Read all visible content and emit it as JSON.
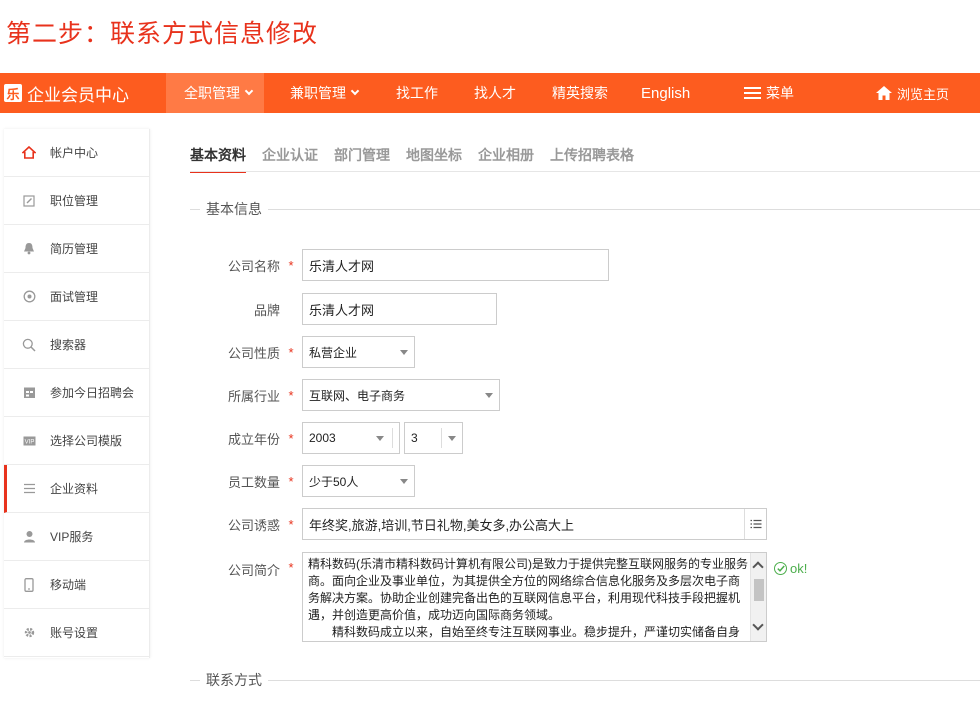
{
  "step_title": "第二步：联系方式信息修改",
  "topbar": {
    "brand_logo": "乐",
    "brand_name": "企业会员中心",
    "nav": [
      {
        "label": "全职管理"
      },
      {
        "label": "兼职管理"
      },
      {
        "label": "找工作"
      },
      {
        "label": "找人才"
      },
      {
        "label": "精英搜索"
      },
      {
        "label": "English"
      },
      {
        "label": "菜单"
      },
      {
        "label": "浏览主页"
      }
    ]
  },
  "sidebar": {
    "items": [
      {
        "label": "帐户中心",
        "icon": "home-icon"
      },
      {
        "label": "职位管理",
        "icon": "edit-icon"
      },
      {
        "label": "简历管理",
        "icon": "bell-icon"
      },
      {
        "label": "面试管理",
        "icon": "clock-icon"
      },
      {
        "label": "搜索器",
        "icon": "search-icon"
      },
      {
        "label": "参加今日招聘会",
        "icon": "calendar-icon"
      },
      {
        "label": "选择公司模版",
        "icon": "vip-icon"
      },
      {
        "label": "企业资料",
        "icon": "list-icon"
      },
      {
        "label": "VIP服务",
        "icon": "user-icon"
      },
      {
        "label": "移动端",
        "icon": "mobile-icon"
      },
      {
        "label": "账号设置",
        "icon": "gear-icon"
      }
    ]
  },
  "tabs": [
    "基本资料",
    "企业认证",
    "部门管理",
    "地图坐标",
    "企业相册",
    "上传招聘表格"
  ],
  "sections": {
    "basic": "基本信息",
    "contact": "联系方式"
  },
  "form": {
    "company_name": {
      "label": "公司名称",
      "value": "乐清人才网"
    },
    "brand": {
      "label": "品牌",
      "value": "乐清人才网"
    },
    "nature": {
      "label": "公司性质",
      "value": "私营企业"
    },
    "industry": {
      "label": "所属行业",
      "value": "互联网、电子商务"
    },
    "founded": {
      "label": "成立年份",
      "year": "2003",
      "month": "3"
    },
    "staff": {
      "label": "员工数量",
      "value": "少于50人"
    },
    "perks": {
      "label": "公司诱惑",
      "value": "年终奖,旅游,培训,节日礼物,美女多,办公高大上"
    },
    "intro": {
      "label": "公司简介",
      "value": "精科数码(乐清市精科数码计算机有限公司)是致力于提供完整互联网服务的专业服务商。面向企业及事业单位，为其提供全方位的网络综合信息化服务及多层次电子商务解决方案。协助企业创建完备出色的互联网信息平台，利用现代科技手段把握机遇，并创造更高价值，成功迈向国际商务领域。\n　　精科数码成立以来，自始至终专注互联网事业。稳步提升，严谨切实储备自身",
      "status": "ok!"
    },
    "required_mark": "*"
  },
  "colors": {
    "brand": "#fd5c1f",
    "accent_red": "#e8321c",
    "ok_green": "#4cae4c"
  }
}
